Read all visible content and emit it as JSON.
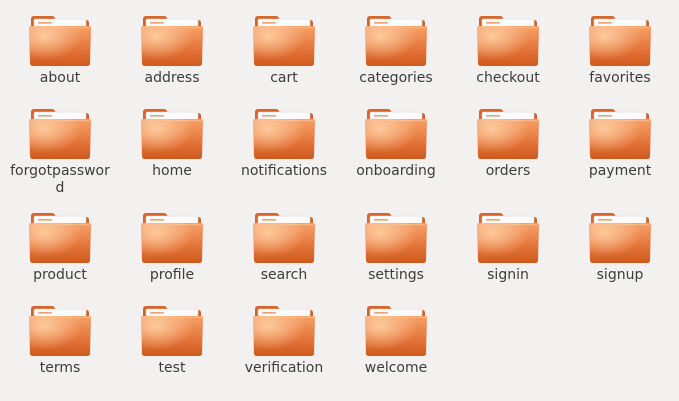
{
  "view": {
    "type": "icon-grid",
    "icon": "folder-icon",
    "colors": {
      "background": "#f2f1f0",
      "folder_front_top": "#f39a5e",
      "folder_front_bottom": "#d35f21",
      "folder_back": "#c8551c",
      "paper": "#fbfbfb",
      "label_text": "#3c3c3c"
    }
  },
  "folders": [
    {
      "label": "about"
    },
    {
      "label": "address"
    },
    {
      "label": "cart"
    },
    {
      "label": "categories"
    },
    {
      "label": "checkout"
    },
    {
      "label": "favorites"
    },
    {
      "label": "forgotpassword"
    },
    {
      "label": "home"
    },
    {
      "label": "notifications"
    },
    {
      "label": "onboarding"
    },
    {
      "label": "orders"
    },
    {
      "label": "payment"
    },
    {
      "label": "product"
    },
    {
      "label": "profile"
    },
    {
      "label": "search"
    },
    {
      "label": "settings"
    },
    {
      "label": "signin"
    },
    {
      "label": "signup"
    },
    {
      "label": "terms"
    },
    {
      "label": "test"
    },
    {
      "label": "verification"
    },
    {
      "label": "welcome"
    }
  ]
}
